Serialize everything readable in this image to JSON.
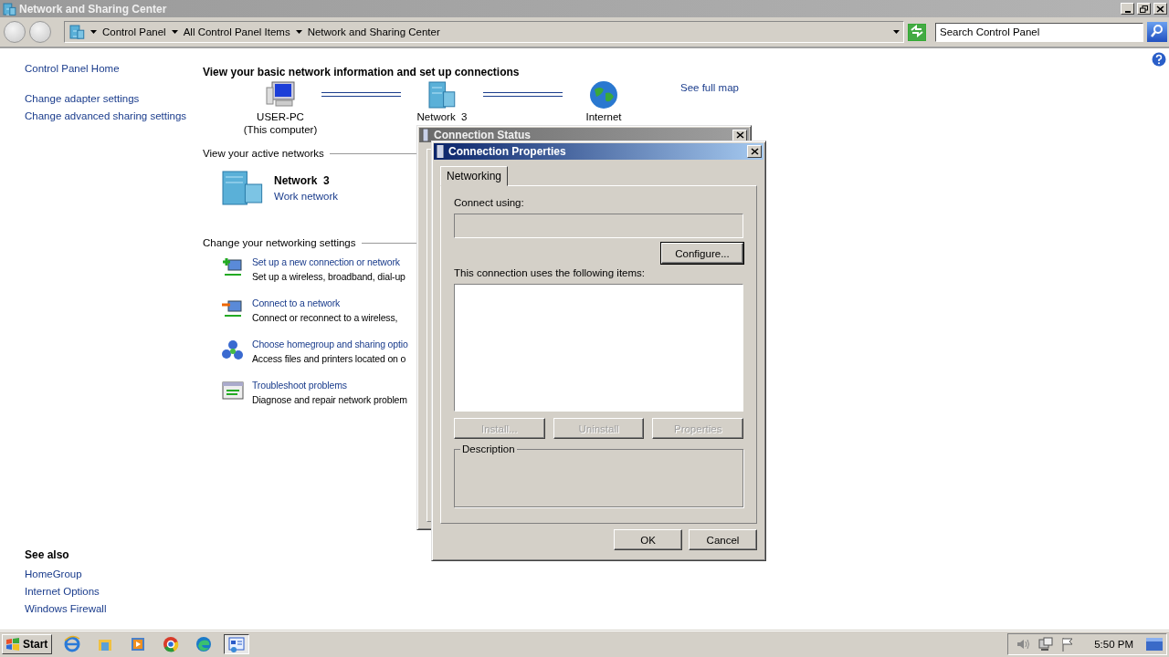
{
  "window": {
    "title": "Network and Sharing Center"
  },
  "address_bar": {
    "breadcrumbs": [
      "Control Panel",
      "All Control Panel Items",
      "Network and Sharing Center"
    ]
  },
  "search": {
    "placeholder": "Search Control Panel"
  },
  "sidebar": {
    "links": [
      "Control Panel Home",
      "Change adapter settings",
      "Change advanced sharing settings"
    ],
    "see_also": {
      "title": "See also",
      "links": [
        "HomeGroup",
        "Internet Options",
        "Windows Firewall"
      ]
    }
  },
  "main": {
    "heading": "View your basic network information and set up connections",
    "map": {
      "nodes": [
        {
          "kind": "computer",
          "label": "USER-PC",
          "sublabel": "(This computer)"
        },
        {
          "kind": "network",
          "label": "Network  3"
        },
        {
          "kind": "internet",
          "label": "Internet"
        }
      ],
      "see_full_map": "See full map"
    },
    "active_networks": {
      "title": "View your active networks",
      "name": "Network  3",
      "type": "Work network"
    },
    "settings": {
      "title": "Change your networking settings",
      "tasks": [
        {
          "kind": "new-connection",
          "link": "Set up a new connection or network",
          "description": "Set up a wireless, broadband, dial-up"
        },
        {
          "kind": "connect",
          "link": "Connect to a network",
          "description": "Connect or reconnect to a wireless,"
        },
        {
          "kind": "homegroup",
          "link": "Choose homegroup and sharing optio",
          "description": "Access files and printers located on o"
        },
        {
          "kind": "troubleshoot",
          "link": "Troubleshoot problems",
          "description": "Diagnose and repair network problem"
        }
      ]
    }
  },
  "status_dialog": {
    "title": "Connection Status"
  },
  "properties_dialog": {
    "title": "Connection Properties",
    "tabs": [
      {
        "label": "Networking",
        "selected": true
      }
    ],
    "connect_using_label": "Connect using:",
    "configure_button": "Configure...",
    "items_label": "This connection uses the following items:",
    "item_buttons": [
      {
        "label": "Install...",
        "disabled": true
      },
      {
        "label": "Uninstall",
        "disabled": true
      },
      {
        "label": "Properties",
        "disabled": true
      }
    ],
    "description_label": "Description",
    "buttons": [
      "OK",
      "Cancel"
    ]
  },
  "taskbar": {
    "start": "Start",
    "apps": [
      {
        "kind": "browser-e",
        "selected": false
      },
      {
        "kind": "folder",
        "selected": false
      },
      {
        "kind": "media",
        "selected": false
      },
      {
        "kind": "chrome",
        "selected": false
      },
      {
        "kind": "edge",
        "selected": false
      },
      {
        "kind": "control-panel",
        "selected": true
      }
    ],
    "clock": "5:50 PM"
  }
}
